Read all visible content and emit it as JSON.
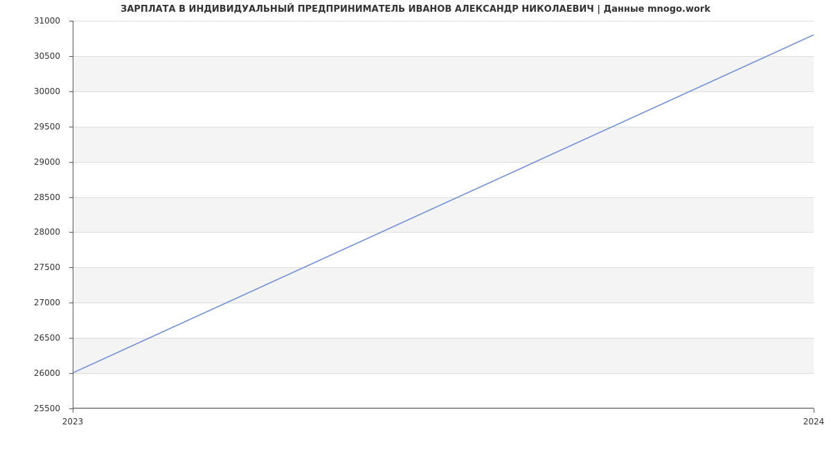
{
  "chart_data": {
    "type": "line",
    "title": "ЗАРПЛАТА В ИНДИВИДУАЛЬНЫЙ ПРЕДПРИНИМАТЕЛЬ ИВАНОВ АЛЕКСАНДР НИКОЛАЕВИЧ | Данные mnogo.work",
    "xlabel": "",
    "ylabel": "",
    "x": [
      2023,
      2024
    ],
    "values": [
      26000,
      30800
    ],
    "x_ticks": [
      2023,
      2024
    ],
    "y_ticks": [
      25500,
      26000,
      26500,
      27000,
      27500,
      28000,
      28500,
      29000,
      29500,
      30000,
      30500,
      31000
    ],
    "xlim": [
      2023,
      2024
    ],
    "ylim": [
      25500,
      31000
    ],
    "line_color": "#6f8fd8"
  }
}
